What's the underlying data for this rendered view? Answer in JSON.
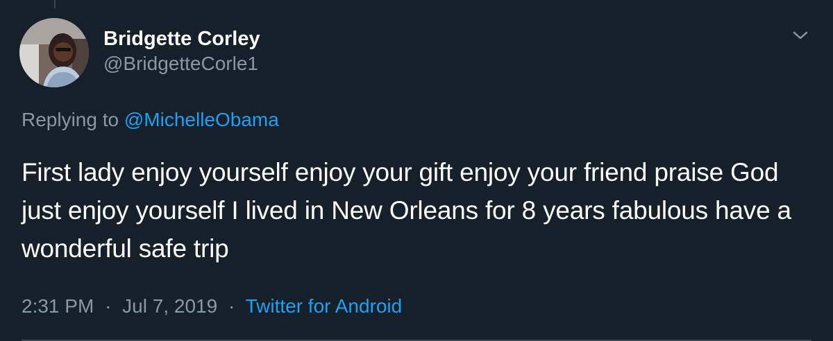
{
  "user": {
    "display_name": "Bridgette Corley",
    "handle": "@BridgetteCorle1"
  },
  "reply": {
    "prefix": "Replying to",
    "mention": "@MichelleObama"
  },
  "tweet": {
    "text": "First lady enjoy yourself enjoy your gift enjoy your friend praise God just enjoy yourself I lived in New Orleans for 8 years fabulous have a wonderful safe trip"
  },
  "meta": {
    "time": "2:31 PM",
    "separator_1": "·",
    "date": "Jul 7, 2019",
    "separator_2": "·",
    "source": "Twitter for Android"
  },
  "icons": {
    "more_options": "chevron-down-icon"
  },
  "colors": {
    "background": "#15202b",
    "primary_text": "#ffffff",
    "secondary_text": "#8899a6",
    "link": "#1da1f2",
    "divider": "#38444d"
  }
}
